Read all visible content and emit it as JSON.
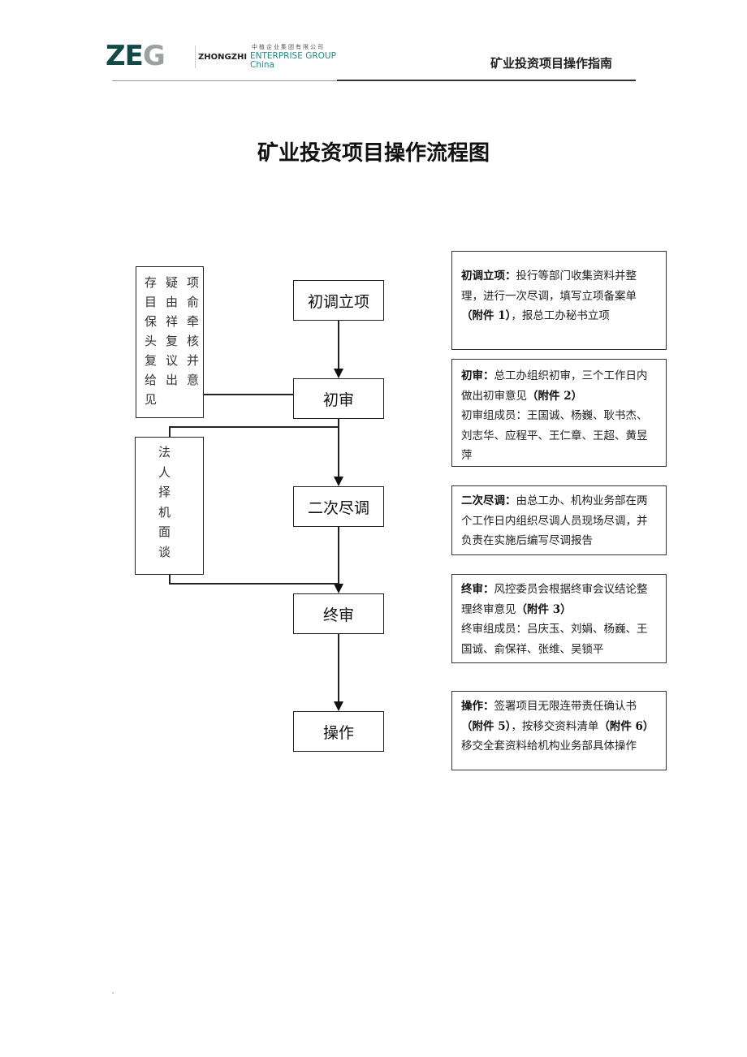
{
  "header": {
    "logo": {
      "mark_primary": "ZE",
      "mark_secondary": "G",
      "chinese_name": "中植企业集团有限公司",
      "name_bold": "ZHONGZHI",
      "name_rest": "ENTERPRISE GROUP",
      "country": "China",
      "colors": {
        "primary": "#0f4a44",
        "secondary": "#9aa39f",
        "accent": "#1f8a8a"
      }
    },
    "doc_title": "矿业投资项目操作指南"
  },
  "page_title": "矿业投资项目操作流程图",
  "flow": {
    "steps": [
      {
        "label": "初调立项"
      },
      {
        "label": "初审"
      },
      {
        "label": "二次尽调"
      },
      {
        "label": "终审"
      },
      {
        "label": "操作"
      }
    ],
    "side_notes": [
      {
        "grid_rows": [
          [
            "存",
            "疑",
            "项"
          ],
          [
            "目",
            "由",
            "俞"
          ],
          [
            "保",
            "祥",
            "牵"
          ],
          [
            "头",
            "复",
            "核"
          ],
          [
            "复",
            "议",
            "并"
          ],
          [
            "给",
            "出",
            "意"
          ],
          [
            "见",
            "",
            ""
          ]
        ]
      },
      {
        "chars": [
          "法",
          "人",
          "择",
          "机",
          "面",
          "谈"
        ]
      }
    ],
    "descriptions": [
      {
        "title": "初调立项",
        "sep": "：",
        "parts": [
          {
            "text": "投行等部门收集资料并整理，进行一次尽调，填写立项备案单",
            "bold": false
          },
          {
            "text": "（附件 1）",
            "bold": true
          },
          {
            "text": "，报总工办秘书立项",
            "bold": false
          }
        ]
      },
      {
        "title": "初审",
        "sep": "：",
        "parts": [
          {
            "text": "总工办组织初审，三个工作日内做出初审意见",
            "bold": false
          },
          {
            "text": "（附件 2）",
            "bold": true
          }
        ],
        "members_label": "初审组成员：",
        "members": "王国诚、杨巍、耿书杰、刘志华、应程平、王仁章、王超、黄昱萍"
      },
      {
        "title": "二次尽调",
        "sep": "：",
        "parts": [
          {
            "text": "由总工办、机构业务部在两个工作日内组织尽调人员现场尽调，并负责在实施后编写尽调报告",
            "bold": false
          }
        ]
      },
      {
        "title": "终审",
        "sep": "：",
        "parts": [
          {
            "text": "风控委员会根据终审会议结论整理终审意见",
            "bold": false
          },
          {
            "text": "（附件 3）",
            "bold": true
          }
        ],
        "members_label": "终审组成员：",
        "members": "吕庆玉、刘娟、杨巍、王国诚、俞保祥、张维、吴锁平"
      },
      {
        "title": "操作",
        "sep": "：",
        "parts": [
          {
            "text": "签署项目无限连带责任确认书",
            "bold": false
          },
          {
            "text": "（附件 5）",
            "bold": true
          },
          {
            "text": "，按移交资料清单",
            "bold": false
          },
          {
            "text": "（附件 6）",
            "bold": true
          },
          {
            "text": "移交全套资料给机构业务部具体操作",
            "bold": false
          }
        ]
      }
    ]
  }
}
